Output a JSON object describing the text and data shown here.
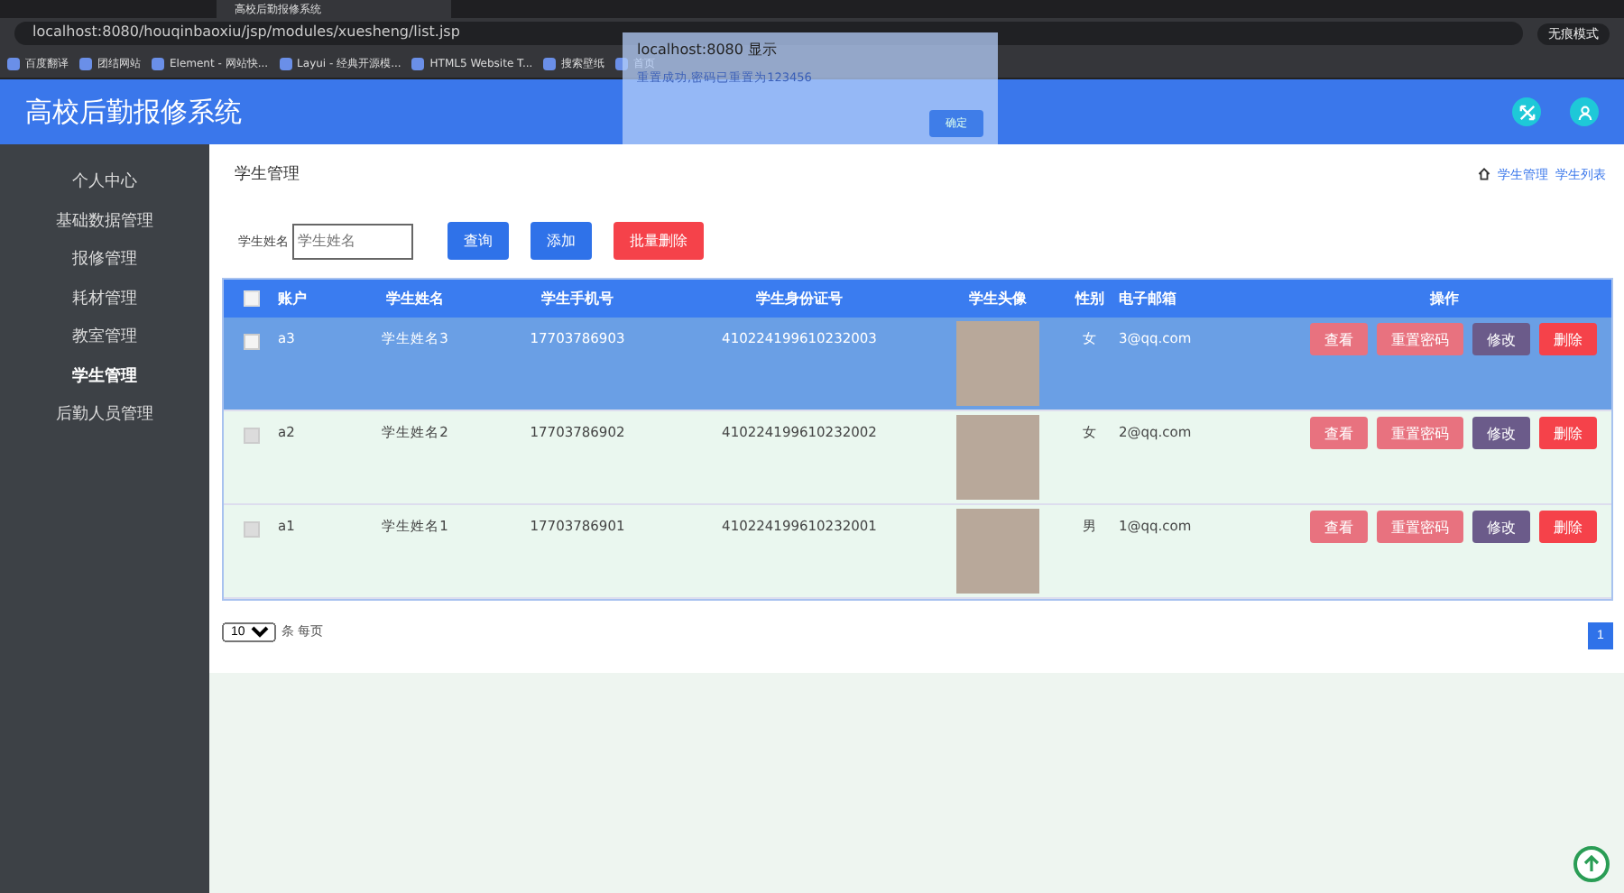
{
  "browser": {
    "tab_title": "高校后勤报修系统",
    "url": "localhost:8080/houqinbaoxiu/jsp/modules/xuesheng/list.jsp",
    "profile": "无痕模式",
    "bookmarks": [
      "百度翻译",
      "团结网站",
      "Element - 网站快...",
      "Layui - 经典开源模...",
      "HTML5 Website T...",
      "搜索壁纸",
      "首页"
    ]
  },
  "header": {
    "title": "高校后勤报修系统"
  },
  "sidebar": {
    "items": [
      {
        "label": "个人中心",
        "selected": false
      },
      {
        "label": "基础数据管理",
        "selected": false
      },
      {
        "label": "报修管理",
        "selected": false
      },
      {
        "label": "耗材管理",
        "selected": false
      },
      {
        "label": "教室管理",
        "selected": false
      },
      {
        "label": "学生管理",
        "selected": true
      },
      {
        "label": "后勤人员管理",
        "selected": false
      }
    ]
  },
  "page": {
    "title": "学生管理",
    "breadcrumb": [
      "学生管理",
      "学生列表"
    ]
  },
  "search": {
    "label": "学生姓名",
    "placeholder": "学生姓名",
    "buttons": [
      {
        "label": "查询",
        "kind": "primary"
      },
      {
        "label": "添加",
        "kind": "primary"
      },
      {
        "label": "批量删除",
        "kind": "danger"
      }
    ]
  },
  "table": {
    "columns": [
      "账户",
      "学生姓名",
      "学生手机号",
      "学生身份证号",
      "学生头像",
      "性别",
      "电子邮箱",
      "操作"
    ],
    "rows": [
      {
        "account": "a3",
        "name": "学生姓名3",
        "phone": "17703786903",
        "id_number": "410224199610232003",
        "gender": "女",
        "email": "3@qq.com",
        "selected": true,
        "actions": [
          {
            "label": "查看",
            "kind": "view"
          },
          {
            "label": "重置密码",
            "kind": "reset"
          },
          {
            "label": "修改",
            "kind": "edit"
          },
          {
            "label": "删除",
            "kind": "delete"
          }
        ]
      },
      {
        "account": "a2",
        "name": "学生姓名2",
        "phone": "17703786902",
        "id_number": "410224199610232002",
        "gender": "女",
        "email": "2@qq.com",
        "selected": false,
        "actions": [
          {
            "label": "查看",
            "kind": "view"
          },
          {
            "label": "重置密码",
            "kind": "reset"
          },
          {
            "label": "修改",
            "kind": "edit"
          },
          {
            "label": "删除",
            "kind": "delete"
          }
        ]
      },
      {
        "account": "a1",
        "name": "学生姓名1",
        "phone": "17703786901",
        "id_number": "410224199610232001",
        "gender": "男",
        "email": "1@qq.com",
        "selected": false,
        "actions": [
          {
            "label": "查看",
            "kind": "view"
          },
          {
            "label": "重置密码",
            "kind": "reset"
          },
          {
            "label": "修改",
            "kind": "edit"
          },
          {
            "label": "删除",
            "kind": "delete"
          }
        ]
      }
    ],
    "select_all_checked": false
  },
  "pagination": {
    "page_size": "10",
    "page_size_label": "条 每页",
    "pages": [
      {
        "label": "1",
        "selected": true
      }
    ]
  },
  "dialog": {
    "title": "localhost:8080 显示",
    "message": "重置成功,密码已重置为123456",
    "button": "确定"
  }
}
